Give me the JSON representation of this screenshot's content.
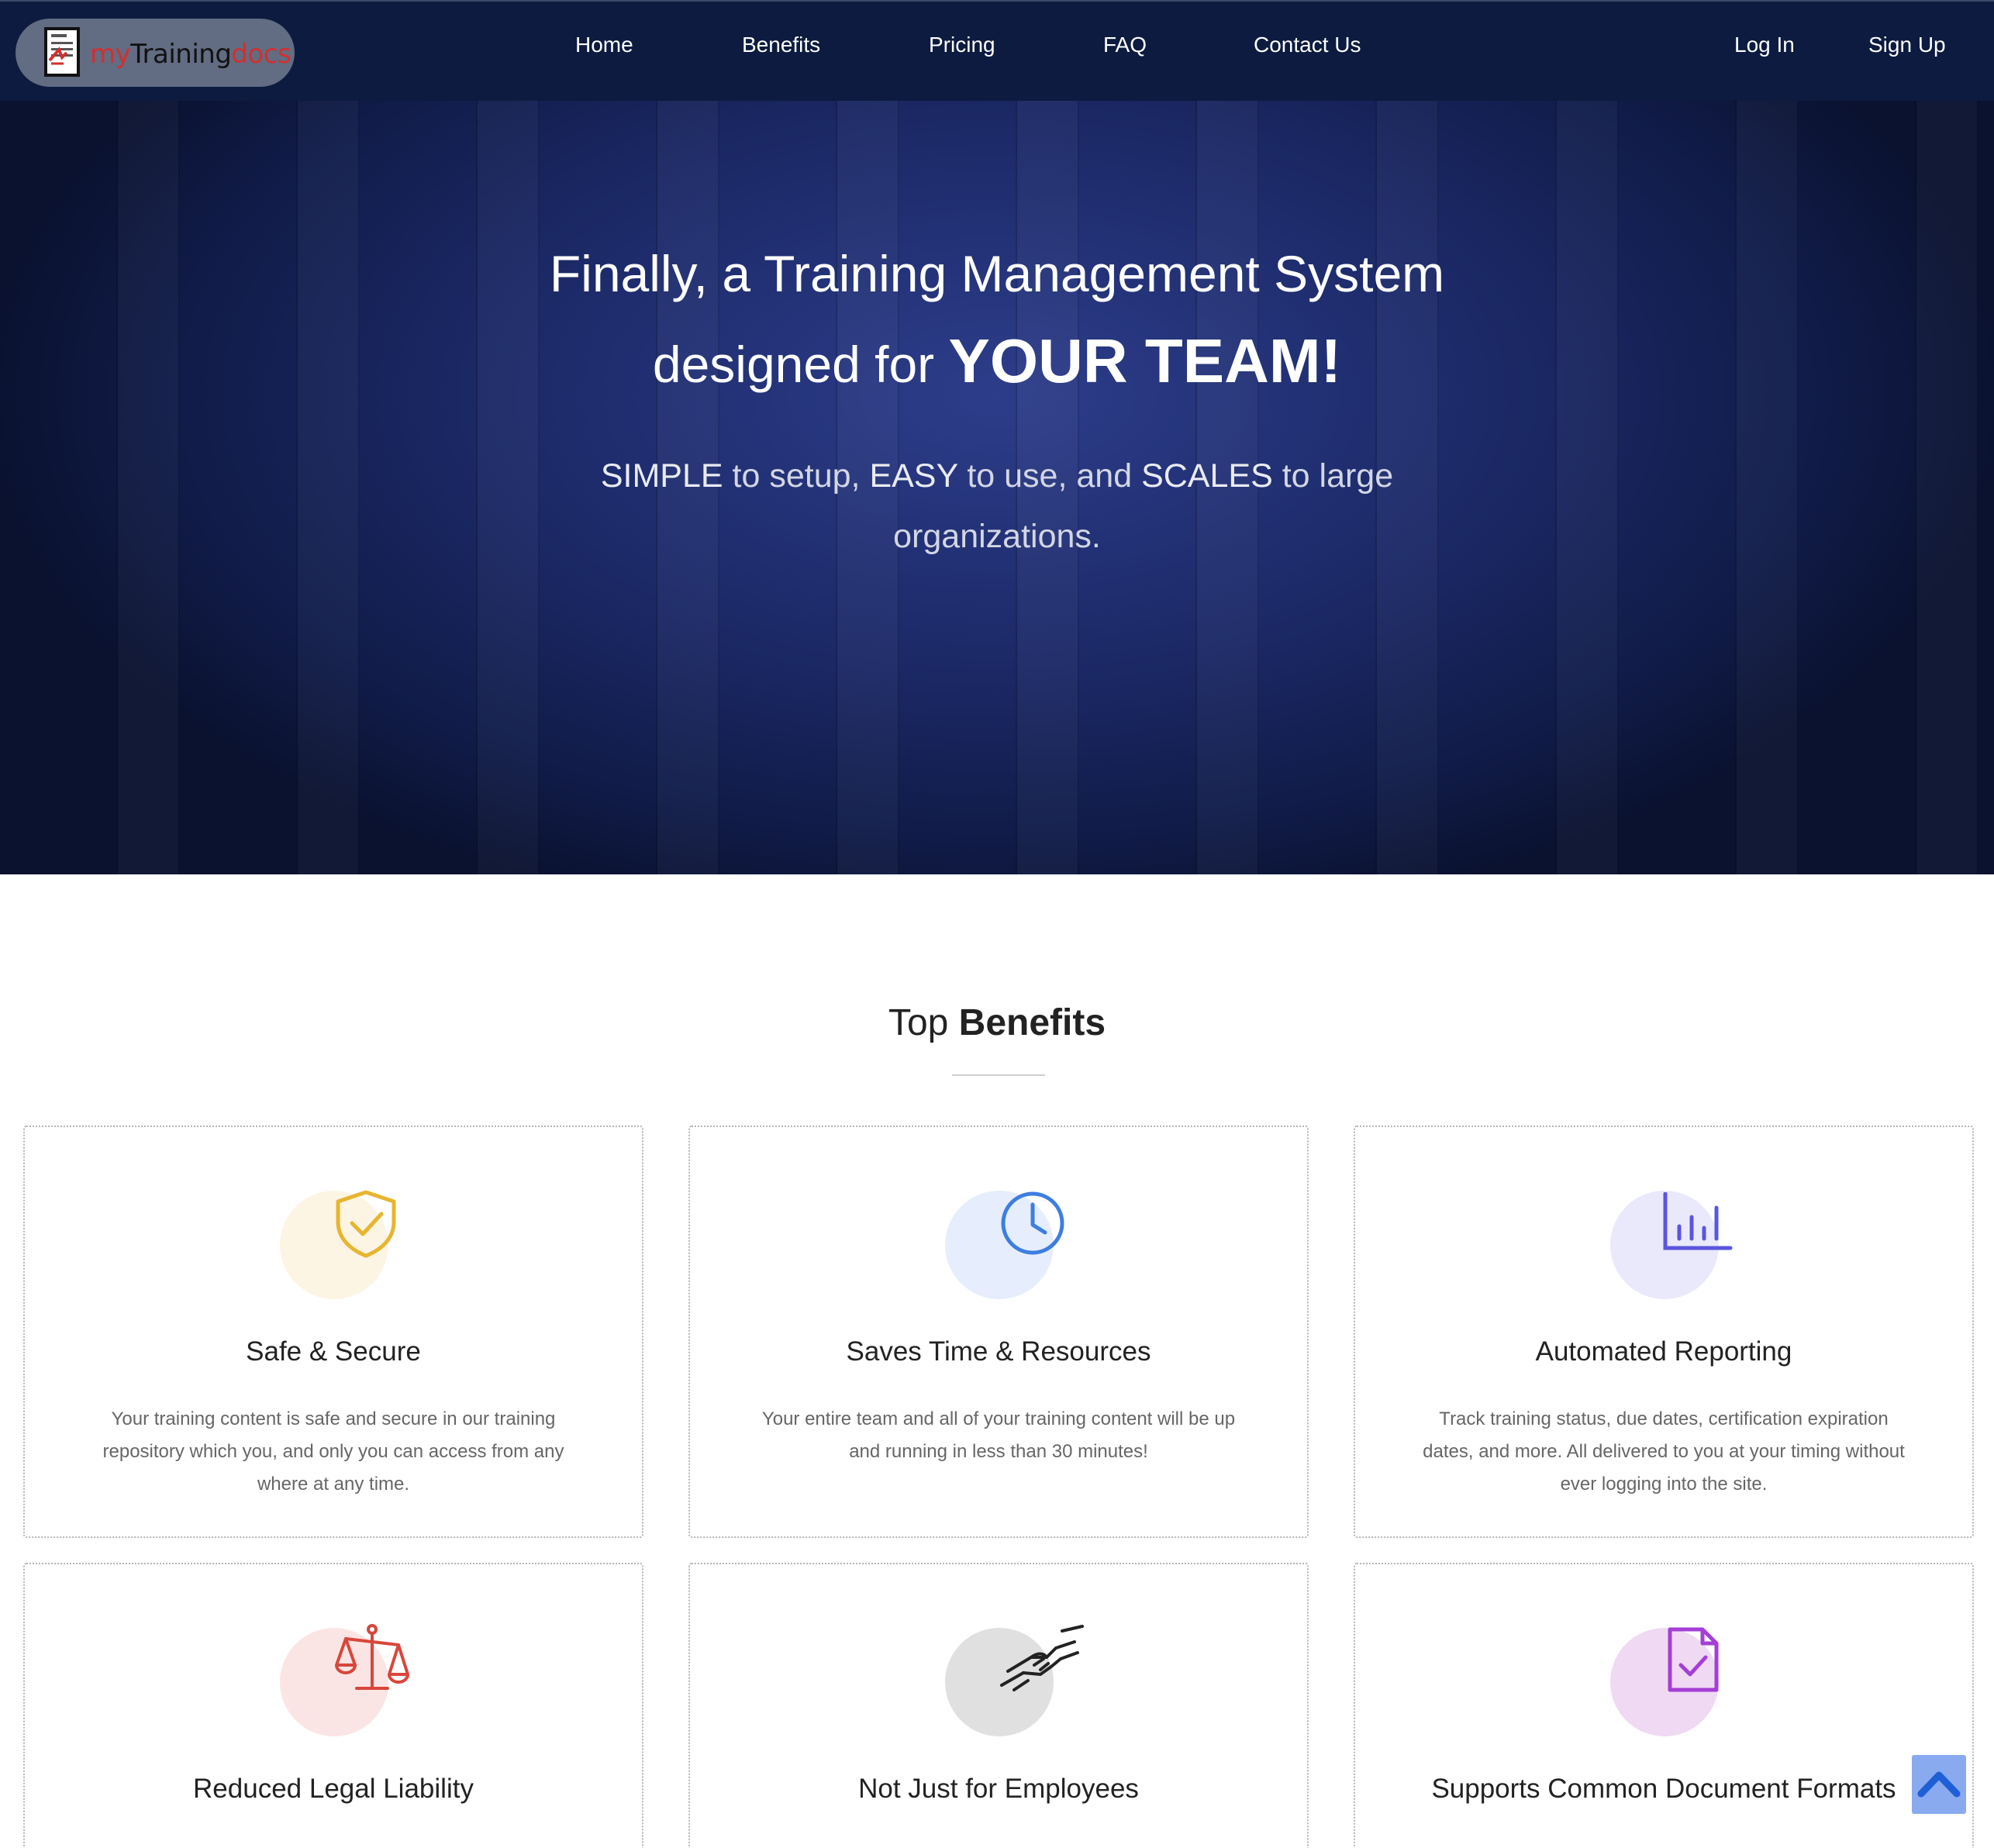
{
  "nav": {
    "logo": {
      "my": "my",
      "training": "Training",
      "docs": "docs"
    },
    "links": [
      "Home",
      "Benefits",
      "Pricing",
      "FAQ",
      "Contact Us"
    ],
    "login": "Log In",
    "signup": "Sign Up"
  },
  "hero": {
    "line1": "Finally, a Training Management System",
    "line2_prefix": "designed for ",
    "line2_emphasis": "YOUR TEAM!",
    "sub": {
      "w1": "SIMPLE",
      "t1": " to setup, ",
      "w2": "EASY",
      "t2": " to use, and ",
      "w3": "SCALES",
      "t3": " to large organizations."
    }
  },
  "benefits": {
    "title_prefix": "Top ",
    "title_bold": "Benefits",
    "cards": [
      {
        "title": "Safe & Secure",
        "text": "Your training content is safe and secure in our training repository which you, and only you can access from any where at any time.",
        "icon": "shield-check-icon",
        "color": "#e8b530",
        "bg": "#fdf5e4"
      },
      {
        "title": "Saves Time & Resources",
        "text": "Your entire team and all of your training content will be up and running in less than 30 minutes!",
        "icon": "clock-icon",
        "color": "#3d7ee0",
        "bg": "#e6edfc"
      },
      {
        "title": "Automated Reporting",
        "text": "Track training status, due dates, certification expiration dates, and more. All delivered to you at your timing without ever logging into the site.",
        "icon": "bar-chart-icon",
        "color": "#5a55e0",
        "bg": "#e9e9fb"
      },
      {
        "title": "Reduced Legal Liability",
        "text": "",
        "icon": "scales-icon",
        "color": "#d9463b",
        "bg": "#fbe5e4"
      },
      {
        "title": "Not Just for Employees",
        "text": "",
        "icon": "handshake-icon",
        "color": "#222222",
        "bg": "#e0e0e0"
      },
      {
        "title": "Supports Common Document Formats",
        "text": "",
        "icon": "document-check-icon",
        "color": "#a53ed6",
        "bg": "#f0d9f3"
      }
    ]
  }
}
